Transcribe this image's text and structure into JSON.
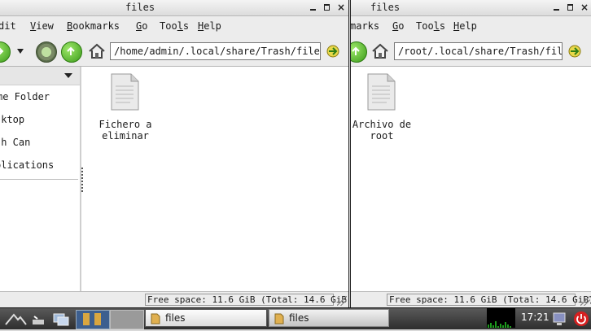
{
  "windows": [
    {
      "title": "files",
      "menus": [
        {
          "label": "dit",
          "ul": "E"
        },
        {
          "label": "iew",
          "ul": "V"
        },
        {
          "label": "ookmarks",
          "ul": "B"
        },
        {
          "label": "o",
          "ul": "G"
        },
        {
          "label": "Too",
          "ul": "l",
          "rest": "s"
        },
        {
          "label": "elp",
          "ul": "H"
        }
      ],
      "location": "/home/admin/.local/share/Trash/files",
      "sidebar_items": [
        "me Folder",
        "sktop",
        "sh Can",
        "plications"
      ],
      "files": [
        {
          "name_line1": "Fichero a",
          "name_line2": "eliminar"
        }
      ],
      "free_space": "Free space: 11.6 GiB (Total: 14.6 GiB)"
    },
    {
      "title": "files",
      "menus": [
        {
          "label": "marks",
          "ul": ""
        },
        {
          "label": "o",
          "ul": "G"
        },
        {
          "label": "Too",
          "ul": "l",
          "rest": "s"
        },
        {
          "label": "elp",
          "ul": "H"
        }
      ],
      "location": "/root/.local/share/Trash/files",
      "files": [
        {
          "name_line1": "Archivo de",
          "name_line2": "root"
        }
      ],
      "free_space": "Free space: 11.6 GiB (Total: 14.6 GiB)"
    }
  ],
  "taskbar": {
    "tasks": [
      {
        "label": "files"
      },
      {
        "label": "files"
      }
    ],
    "clock": "17:21"
  },
  "colors": {
    "accent_green": "#3b9b1a",
    "power_red": "#d62020"
  }
}
